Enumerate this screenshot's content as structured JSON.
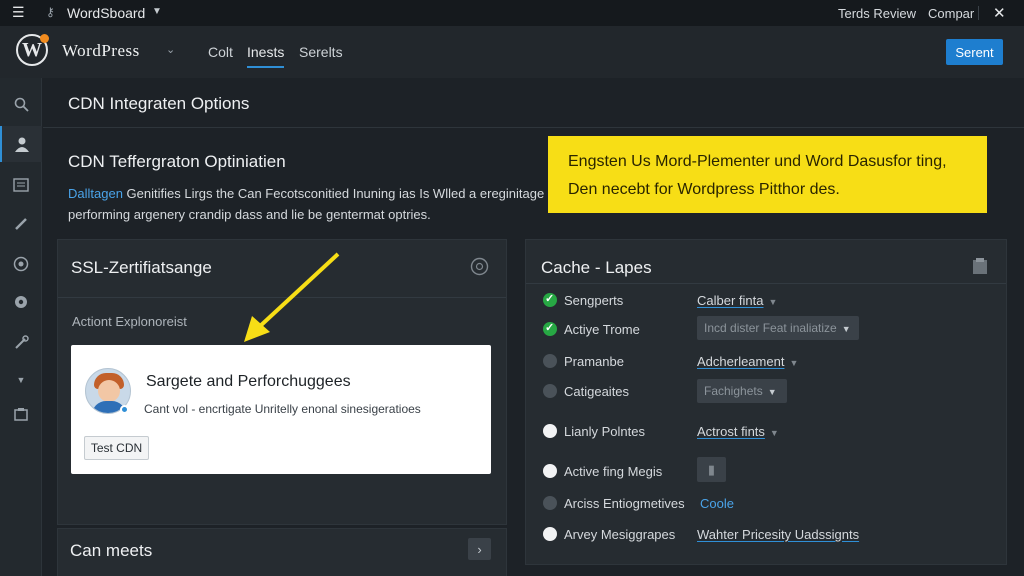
{
  "topbar": {
    "app_title": "WordSboard",
    "right_link_1": "Terds Review",
    "right_link_2": "Compar"
  },
  "header": {
    "brand": "WordPress",
    "tabs": [
      {
        "label": "Colt",
        "active": false
      },
      {
        "label": "Inests",
        "active": true
      },
      {
        "label": "Serelts",
        "active": false
      }
    ],
    "search_button": "Serent",
    "accent_color": "#1e7ecf"
  },
  "page": {
    "title": "CDN Integraten Options",
    "subtitle": "CDN Teffergraton Optiniatien",
    "desc_link": "Dalltagen",
    "desc_line1": " Genitifies Lirgs the Can Fecotsconitied Inuning ias Is Wlled a ereginitage",
    "desc_line2": "performing argenery crandip dass and lie be gentermat optries."
  },
  "notice": {
    "line1": "Engsten Us Mord-Plementer und Word Dasusfor ting,",
    "line2": "Den necebt for Wordpress Pitthor des.",
    "color": "#f7de16"
  },
  "ssl_panel": {
    "title": "SSL-Zertifiatsange",
    "action_label": "Actiont Explonoreist",
    "card": {
      "title": "Sargete and Perforchuggees",
      "subtitle": "Cant vol - encrtigate Unritelly enonal sinesigeratioes",
      "button": "Test CDN"
    }
  },
  "bottom": {
    "title": "Can meets"
  },
  "cache_panel": {
    "title": "Cache - Lapes",
    "rows": [
      {
        "label": "Sengperts",
        "status": "on",
        "control": "link",
        "value": "Calber finta"
      },
      {
        "label": "Actiye Trome",
        "status": "on",
        "control": "select",
        "value": "Incd dister Feat inaliatize"
      },
      {
        "label": "Pramanbe",
        "status": "off",
        "control": "link",
        "value": "Adcherleament"
      },
      {
        "label": "Catigeaites",
        "status": "off",
        "control": "select",
        "value": "Fachighets"
      },
      {
        "label": "Lianly Polntes",
        "status": "white",
        "control": "link",
        "value": "Actrost fints"
      },
      {
        "label": "Active fing Megis",
        "status": "white",
        "control": "small",
        "value": ""
      },
      {
        "label": "Arciss Entiogmetives",
        "status": "off",
        "control": "plain-blue",
        "value": "Coole"
      },
      {
        "label": "Arvey Mesiggrapes",
        "status": "white",
        "control": "link-plain",
        "value": "Wahter Pricesity Uadssignts"
      }
    ]
  }
}
